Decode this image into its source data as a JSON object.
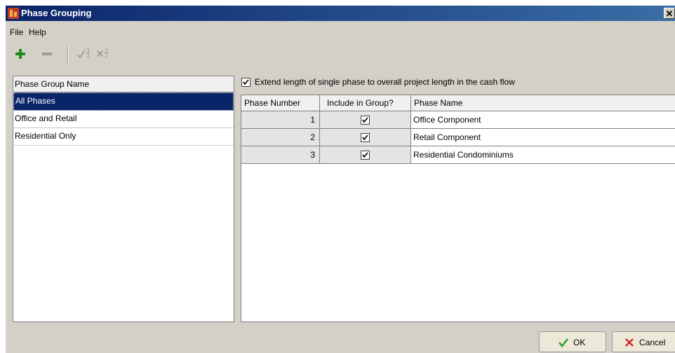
{
  "window": {
    "title": "Phase Grouping",
    "close_glyph": "✕"
  },
  "menu": {
    "file": "File",
    "help": "Help"
  },
  "toolbar": {
    "add_icon": "plus-icon",
    "remove_icon": "minus-icon",
    "check_all_icon": "check-all-icon",
    "uncheck_all_icon": "uncheck-all-icon"
  },
  "groups": {
    "header": "Phase Group Name",
    "items": [
      {
        "label": "All Phases",
        "selected": true
      },
      {
        "label": "Office and Retail",
        "selected": false
      },
      {
        "label": "Residential Only",
        "selected": false
      }
    ]
  },
  "extend_option": {
    "label": "Extend length of single phase to overall project length in the cash flow",
    "checked": true
  },
  "phases": {
    "columns": [
      "Phase Number",
      "Include in Group?",
      "Phase Name"
    ],
    "rows": [
      {
        "number": "1",
        "included": true,
        "name": "Office Component"
      },
      {
        "number": "2",
        "included": true,
        "name": "Retail Component"
      },
      {
        "number": "3",
        "included": true,
        "name": "Residential Condominiums"
      }
    ]
  },
  "buttons": {
    "ok": "OK",
    "cancel": "Cancel"
  },
  "colors": {
    "title_bar": "#0a246a",
    "selected_row": "#0a246a",
    "ok_check": "#2e9e2e",
    "cancel_x": "#d01010",
    "add_plus": "#1d8a1d"
  }
}
